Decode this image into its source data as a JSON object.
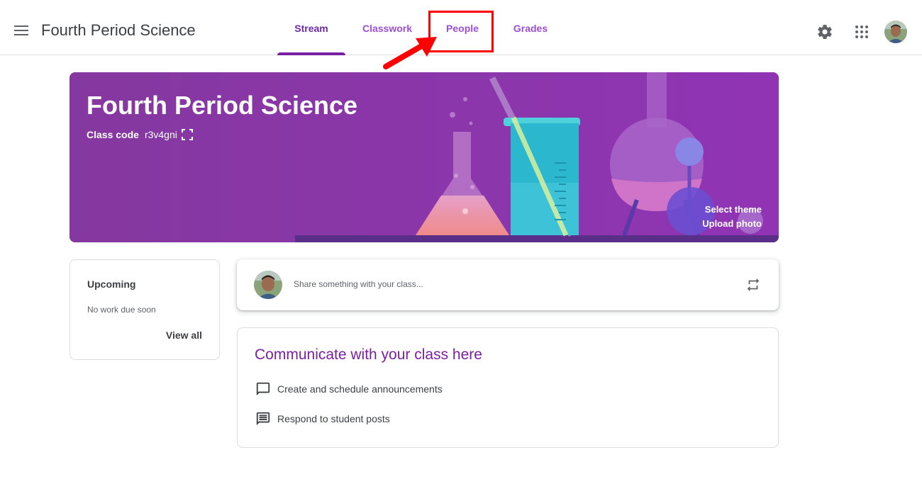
{
  "app": {
    "class_title": "Fourth Period Science"
  },
  "tabs": [
    {
      "label": "Stream",
      "active": true
    },
    {
      "label": "Classwork",
      "active": false
    },
    {
      "label": "People",
      "active": false
    },
    {
      "label": "Grades",
      "active": false
    }
  ],
  "icons": {
    "menu": "hamburger-menu-icon",
    "settings": "gear-icon",
    "apps": "apps-grid-icon",
    "expand": "fullscreen-icon",
    "repost": "repeat-icon",
    "announce": "chat-bubble-icon",
    "posts": "message-lines-icon"
  },
  "banner": {
    "title": "Fourth Period Science",
    "class_code_label": "Class code",
    "class_code": "r3v4gni",
    "select_theme": "Select theme",
    "upload_photo": "Upload photo"
  },
  "upcoming": {
    "title": "Upcoming",
    "empty_text": "No work due soon",
    "view_all": "View all"
  },
  "share": {
    "placeholder": "Share something with your class..."
  },
  "communicate": {
    "title": "Communicate with your class here",
    "items": [
      {
        "label": "Create and schedule announcements"
      },
      {
        "label": "Respond to student posts"
      }
    ]
  },
  "colors": {
    "accent": "#7b1fa2",
    "tab_text": "#9d4ed6",
    "banner_bg": "#8a3ba3",
    "annotation": "#ff0000"
  }
}
